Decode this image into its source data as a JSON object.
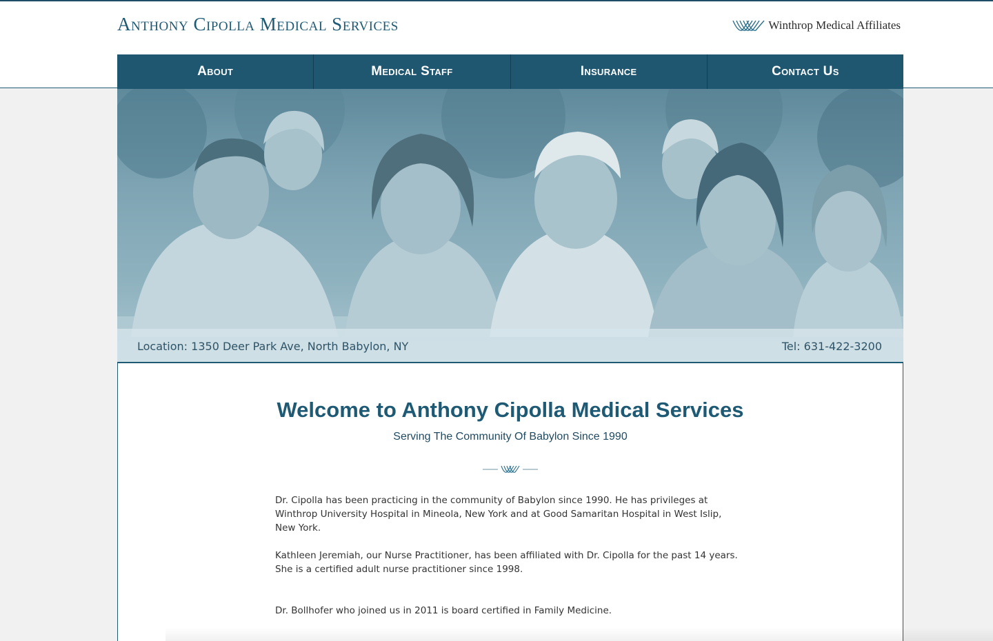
{
  "header": {
    "site_title": "Anthony Cipolla Medical Services",
    "affiliate_name": "Winthrop Medical Affiliates",
    "affiliate_logo_icon": "winthrop-wave-logo"
  },
  "nav": {
    "items": [
      {
        "label": "About"
      },
      {
        "label": "Medical Staff"
      },
      {
        "label": "Insurance"
      },
      {
        "label": "Contact Us"
      }
    ]
  },
  "hero": {
    "location": "Location: 1350 Deer Park Ave, North Babylon, NY",
    "tel": "Tel: 631-422-3200",
    "image_icon": "family-photo"
  },
  "main": {
    "title": "Welcome to Anthony Cipolla Medical Services",
    "subtitle": "Serving The Community Of Babylon Since 1990",
    "paragraphs": [
      "Dr. Cipolla has been practicing in the community of Babylon since 1990. He has privileges at Winthrop University Hospital in Mineola, New York and at Good Samaritan Hospital in West Islip, New York.",
      "Kathleen Jeremiah, our Nurse Practitioner, has been affiliated with Dr. Cipolla for the past 14 years. She is a certified adult nurse practitioner since 1998.",
      "Dr. Bollhofer who joined us in 2011 is board certified in Family Medicine."
    ]
  },
  "colors": {
    "brand": "#1f5a75",
    "nav_bg": "#1f5670",
    "page_bg": "#f1f1f1"
  }
}
